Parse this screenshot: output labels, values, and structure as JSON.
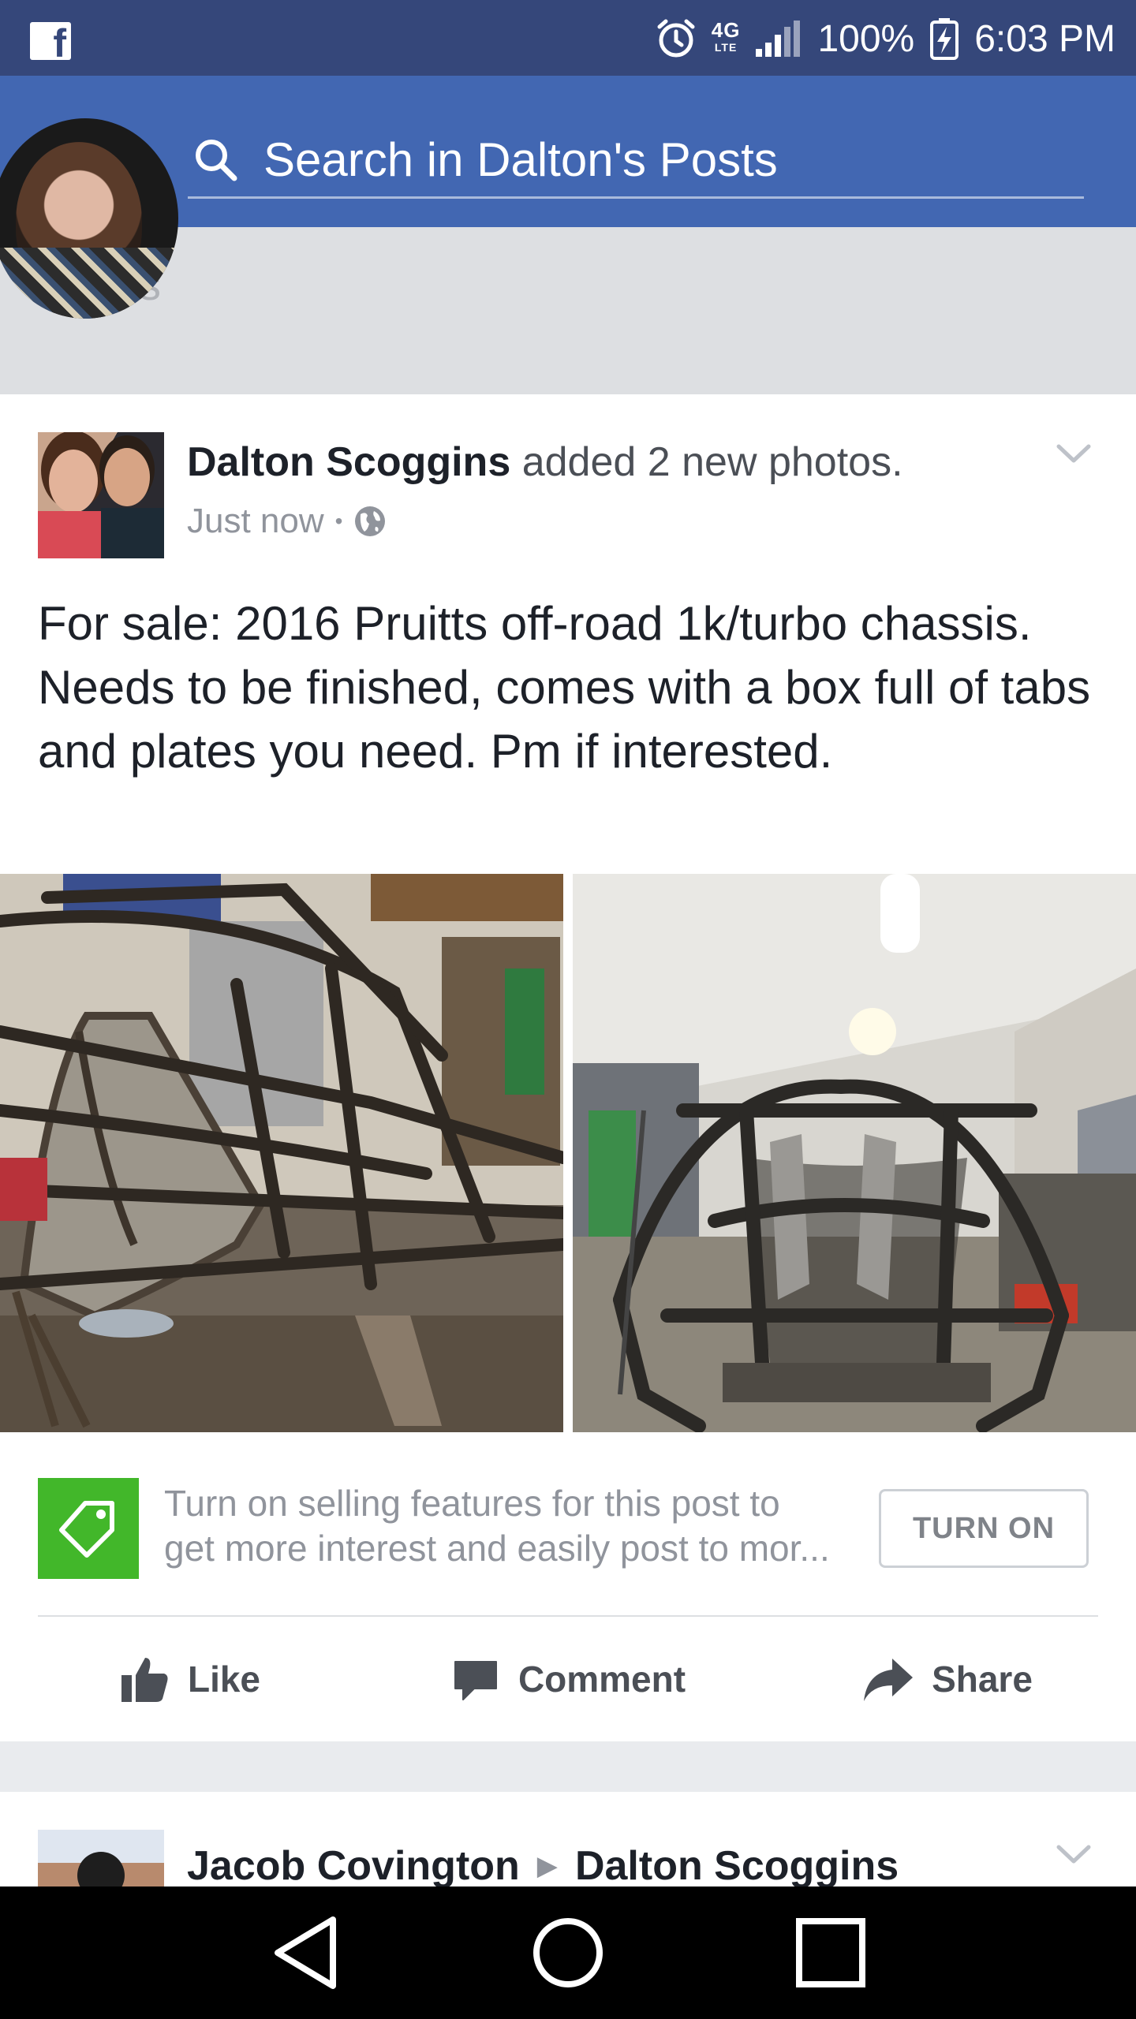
{
  "status_bar": {
    "network": "4G",
    "network_sub": "LTE",
    "battery": "100%",
    "time": "6:03 PM",
    "icons": [
      "facebook-icon",
      "alarm-icon",
      "network-icon",
      "signal-icon",
      "battery-charging-icon"
    ]
  },
  "search": {
    "placeholder": "Search in Dalton's Posts"
  },
  "cover": {
    "ghost_text": "s"
  },
  "post": {
    "author": "Dalton Scoggins",
    "action": " added 2 new photos.",
    "time": "Just now",
    "separator": "•",
    "privacy_icon": "globe-icon",
    "text": "For sale: 2016 Pruitts off-road 1k/turbo chassis. Needs to be finished, comes with a box full of tabs and plates you need. Pm if interested.",
    "photo_count": 2
  },
  "selling": {
    "line1": "Turn on selling features for this post to",
    "line2": "get more interest and easily post to mor...",
    "button": "TURN ON",
    "color": "#42b72a"
  },
  "actions": {
    "like": "Like",
    "comment": "Comment",
    "share": "Share"
  },
  "next_post": {
    "from": "Jacob Covington",
    "arrow": "▶",
    "to": "Dalton Scoggins"
  },
  "colors": {
    "status_bar": "#35477a",
    "header": "#4267b2",
    "text_primary": "#1d2129",
    "text_secondary": "#90949c"
  }
}
